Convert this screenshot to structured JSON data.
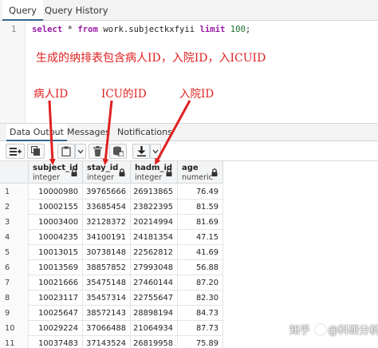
{
  "top_tabs": {
    "query": "Query",
    "history": "Query History"
  },
  "editor": {
    "line_number": "1",
    "tokens": {
      "select": "select",
      "star": " * ",
      "from": "from",
      "table": " work.subjectkxfyii ",
      "limit": "limit",
      "n": " 100",
      "semi": ";"
    }
  },
  "annotations": {
    "main": "生成的纳排表包含病人ID，入院ID，入ICUID",
    "patient": "病人ID",
    "icu": "ICU的ID",
    "admission": "入院ID",
    "color": "#e02020"
  },
  "output_tabs": {
    "data_output": "Data Output",
    "messages": "Messages",
    "notifications": "Notifications"
  },
  "toolbar": {
    "icons": [
      "add-row-icon",
      "copy-icon",
      "paste-icon",
      "chevron-down-icon",
      "delete-icon",
      "save-data-icon",
      "download-icon",
      "chevron-down-icon"
    ]
  },
  "table": {
    "columns": [
      {
        "name": "subject_id",
        "type": "integer"
      },
      {
        "name": "stay_id",
        "type": "integer"
      },
      {
        "name": "hadm_id",
        "type": "integer"
      },
      {
        "name": "age",
        "type": "numeric"
      }
    ],
    "rows": [
      [
        "1",
        "10000980",
        "39765666",
        "26913865",
        "76.49"
      ],
      [
        "2",
        "10002155",
        "33685454",
        "23822395",
        "81.59"
      ],
      [
        "3",
        "10003400",
        "32128372",
        "20214994",
        "81.69"
      ],
      [
        "4",
        "10004235",
        "34100191",
        "24181354",
        "47.15"
      ],
      [
        "5",
        "10013015",
        "30738148",
        "22562812",
        "41.69"
      ],
      [
        "6",
        "10013569",
        "38857852",
        "27993048",
        "56.88"
      ],
      [
        "7",
        "10021666",
        "35475148",
        "27460144",
        "87.20"
      ],
      [
        "8",
        "10023117",
        "35457314",
        "22755647",
        "82.30"
      ],
      [
        "9",
        "10025647",
        "38572143",
        "28898194",
        "84.73"
      ],
      [
        "10",
        "10029224",
        "37066488",
        "21064934",
        "87.73"
      ],
      [
        "11",
        "10037483",
        "37143524",
        "26819958",
        "75.89"
      ]
    ]
  },
  "watermark": {
    "text_left": "知乎",
    "at": "@",
    "text_right": "科研分析"
  }
}
